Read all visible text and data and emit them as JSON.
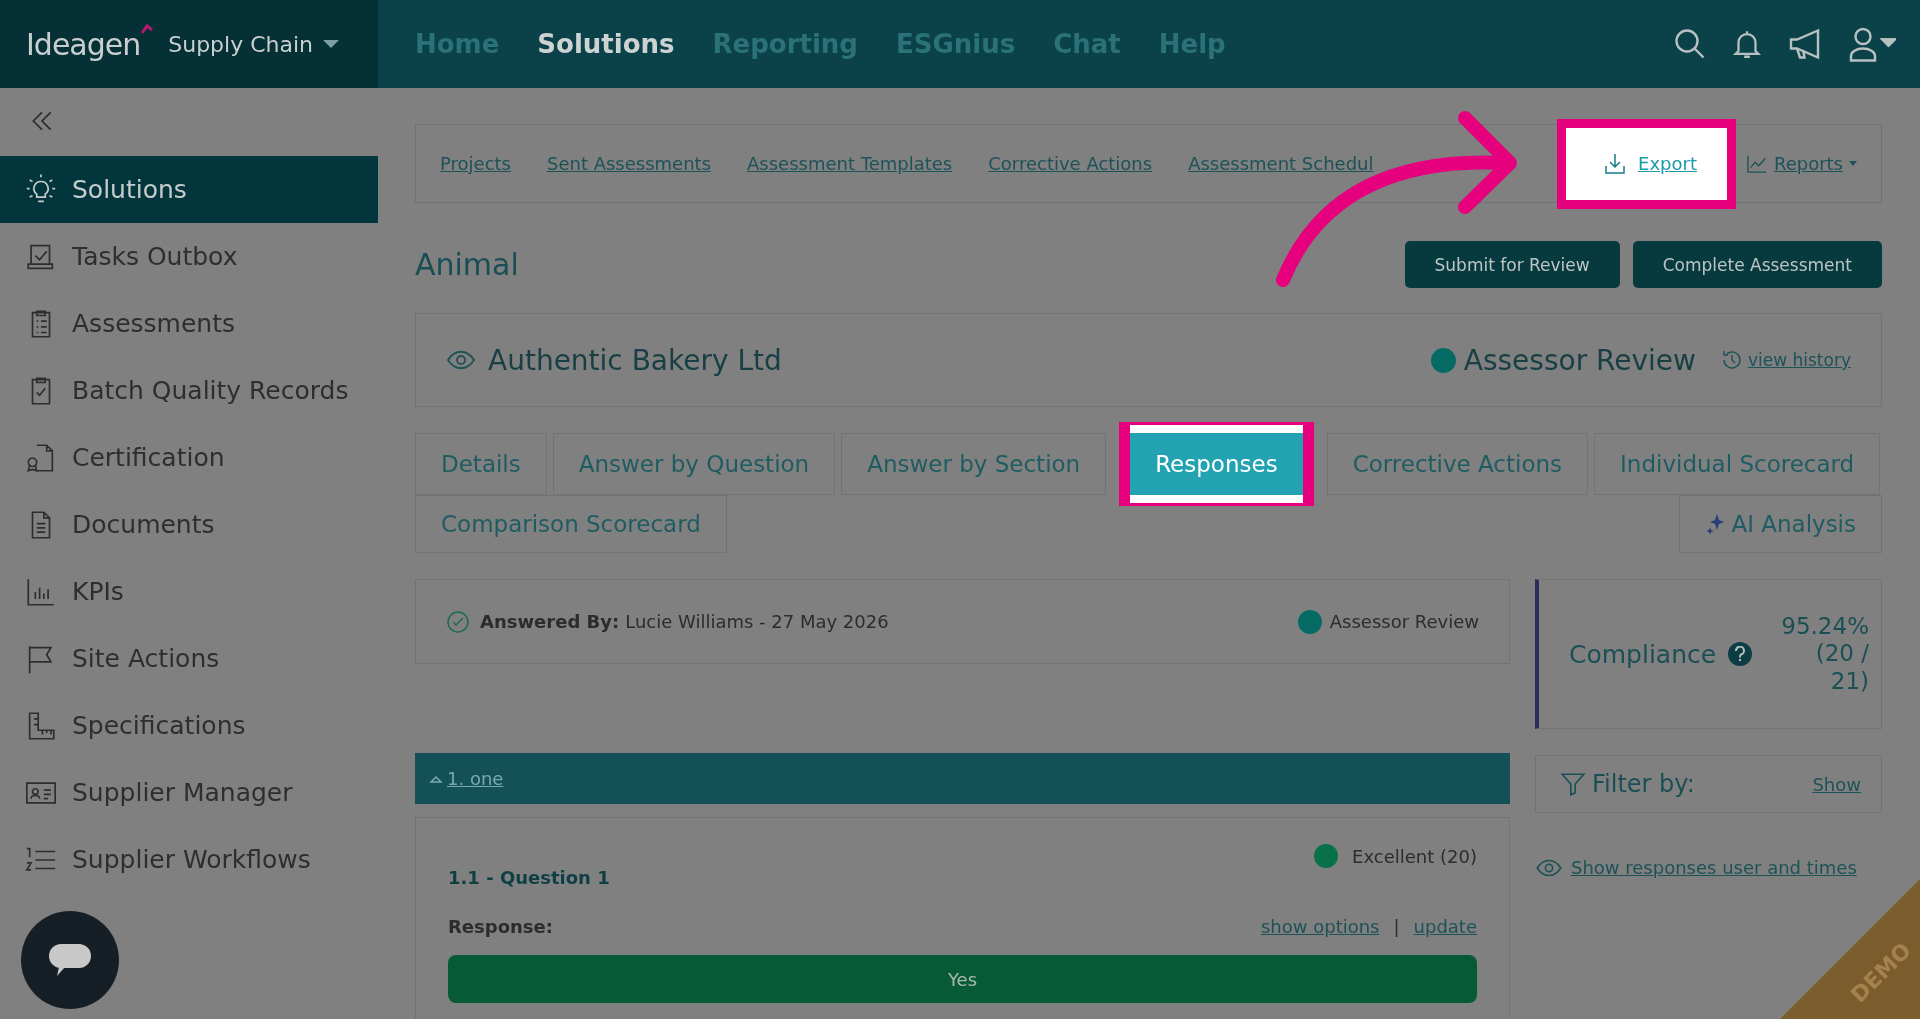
{
  "brand": {
    "logo": "Ideagen",
    "product": "Supply Chain"
  },
  "nav": [
    {
      "label": "Home",
      "selected": false
    },
    {
      "label": "Solutions",
      "selected": true
    },
    {
      "label": "Reporting",
      "selected": false
    },
    {
      "label": "ESGnius",
      "selected": false
    },
    {
      "label": "Chat",
      "selected": false
    },
    {
      "label": "Help",
      "selected": false
    }
  ],
  "sidebar": {
    "items": [
      {
        "label": "Solutions",
        "selected": true
      },
      {
        "label": "Tasks Outbox",
        "selected": false
      },
      {
        "label": "Assessments",
        "selected": false
      },
      {
        "label": "Batch Quality Records",
        "selected": false
      },
      {
        "label": "Certification",
        "selected": false
      },
      {
        "label": "Documents",
        "selected": false
      },
      {
        "label": "KPIs",
        "selected": false
      },
      {
        "label": "Site Actions",
        "selected": false
      },
      {
        "label": "Specifications",
        "selected": false
      },
      {
        "label": "Supplier Manager",
        "selected": false
      },
      {
        "label": "Supplier Workflows",
        "selected": false
      }
    ]
  },
  "subnav": {
    "links": [
      "Projects",
      "Sent Assessments",
      "Assessment Templates",
      "Corrective Actions",
      "Assessment Schedul"
    ],
    "export": {
      "label": "Export",
      "highlighted": true
    },
    "reports": "Reports"
  },
  "page_title": "Animal",
  "actions": [
    "Submit for Review",
    "Complete Assessment"
  ],
  "supplier": {
    "name": "Authentic Bakery Ltd",
    "status": {
      "label": "Assessor Review",
      "color": "#046a63"
    },
    "history_link": "view history"
  },
  "tab_rows": [
    [
      {
        "label": "Details",
        "selected": false,
        "highlighted": false
      },
      {
        "label": "Answer by Question",
        "selected": false,
        "highlighted": false
      },
      {
        "label": "Answer by Section",
        "selected": false,
        "highlighted": false
      },
      {
        "label": "Responses",
        "selected": true,
        "highlighted": true
      },
      {
        "label": "Corrective Actions",
        "selected": false,
        "highlighted": false
      },
      {
        "label": "Individual Scorecard",
        "selected": false,
        "highlighted": false
      }
    ],
    [
      {
        "label": "Comparison Scorecard",
        "selected": false,
        "highlighted": false
      },
      {
        "label": "AI Analysis",
        "selected": false,
        "highlighted": false,
        "kind": "ai"
      }
    ]
  ],
  "answered": {
    "label": "Answered By:",
    "value": "Lucie Williams - 27 May 2026",
    "status": {
      "label": "Assessor Review",
      "color": "#046a63"
    }
  },
  "compliance": {
    "label": "Compliance",
    "value": "95.24%",
    "detail": "(20 / 21)"
  },
  "section": {
    "label": "1. one",
    "expanded": true
  },
  "filter": {
    "label": "Filter by:",
    "link": "Show"
  },
  "show_responses_link": "Show responses user and times",
  "question": {
    "title": "1.1 - Question 1",
    "score": {
      "label": "Excellent (20)",
      "color": "#08714a"
    },
    "response_label": "Response:",
    "links": [
      "show options",
      "update"
    ],
    "separator": "|",
    "answer": "Yes"
  },
  "demo_ribbon": "DEMO"
}
